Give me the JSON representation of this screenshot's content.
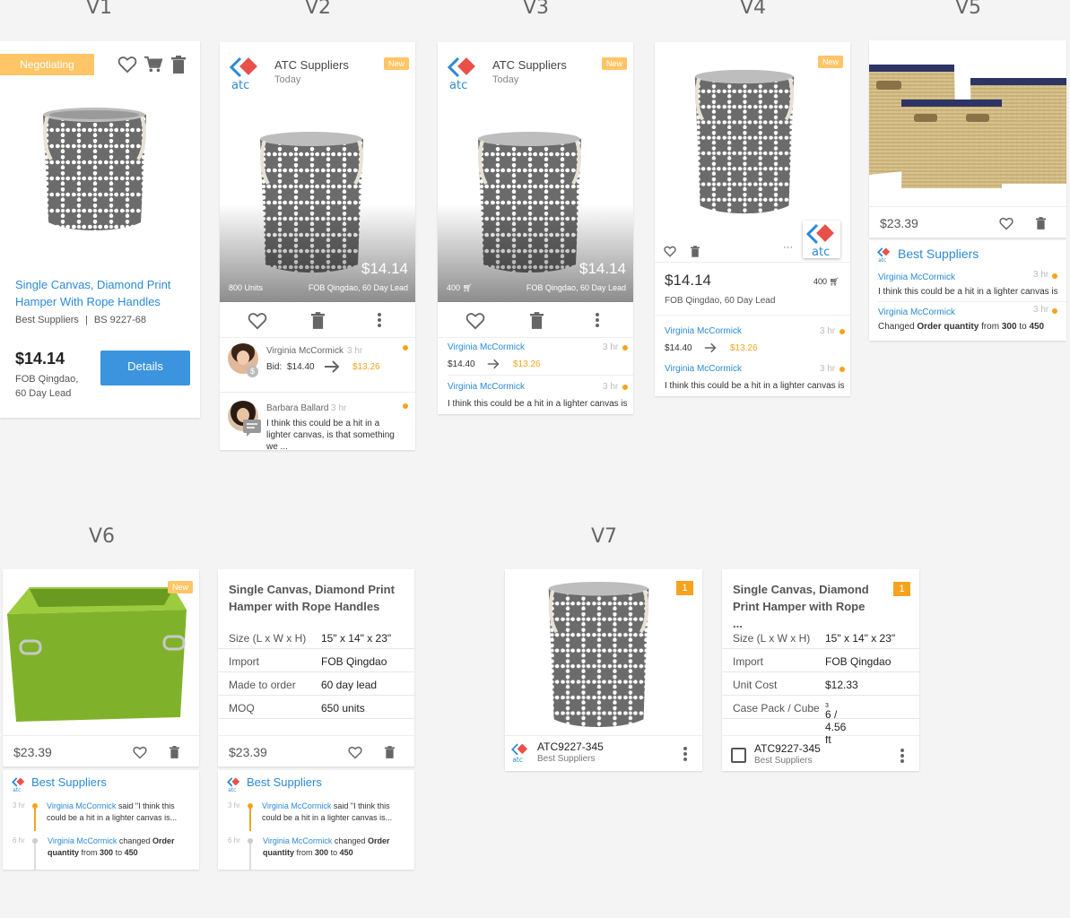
{
  "version_labels": [
    "V1",
    "V2",
    "V3",
    "V4",
    "V5",
    "V6",
    "V7"
  ],
  "colors": {
    "accent_blue": "#2b8ad6",
    "accent_orange": "#f5a31e",
    "badge_yellow": "#ffc566",
    "green_bin": "#7fb22a"
  },
  "v1": {
    "status_badge": "Negotiating",
    "title": "Single Canvas, Diamond Print Hamper With Rope Handles",
    "supplier": "Best Suppliers",
    "separator": "|",
    "sku": "BS 9227-68",
    "price": "$14.14",
    "terms": "FOB Qingdao, 60 Day Lead",
    "details_label": "Details"
  },
  "v2": {
    "supplier": "ATC Suppliers",
    "date": "Today",
    "badge": "New",
    "price": "$14.14",
    "units": "800 Units",
    "terms": "FOB Qingdao, 60 Day Lead",
    "bid_user": "Virginia McCormick",
    "bid_time": "3 hr",
    "bid_label": "Bid:",
    "bid_from": "$14.40",
    "bid_to": "$13.26",
    "comment_user": "Barbara Ballard",
    "comment_time": "3 hr",
    "comment_text": "I think this could be a hit in a lighter canvas, is that something we ..."
  },
  "v3": {
    "supplier": "ATC Suppliers",
    "date": "Today",
    "badge": "New",
    "price": "$14.14",
    "units": "400",
    "terms": "FOB Qingdao, 60 Day Lead",
    "act1_user": "Virginia McCormick",
    "act1_time": "3 hr",
    "act1_from": "$14.40",
    "act1_to": "$13.26",
    "act2_user": "Virginia McCormick",
    "act2_time": "3 hr",
    "act2_text": "I think this could be a hit in a lighter canvas is..."
  },
  "v4": {
    "badge": "New",
    "price": "$14.14",
    "units": "400",
    "terms": "FOB Qingdao, 60 Day Lead",
    "logo_text": "atc",
    "more": "···",
    "act1_user": "Virginia McCormick",
    "act1_time": "3 hr",
    "act1_from": "$14.40",
    "act1_to": "$13.26",
    "act2_user": "Virginia McCormick",
    "act2_time": "3 hr",
    "act2_text": "I think this could be a hit in a lighter canvas is..."
  },
  "v5": {
    "price": "$23.39",
    "supplier": "Best Suppliers",
    "act1_user": "Virginia McCormick",
    "act1_time": "3 hr",
    "act1_text": "I think this could be a hit in a lighter canvas is...",
    "act2_user": "Virginia McCormick",
    "act2_time": "3 hr",
    "act2_changed": "Changed",
    "act2_field": "Order quantity",
    "act2_from_word": "from",
    "act2_from": "300",
    "act2_to_word": "to",
    "act2_to": "450"
  },
  "v6": {
    "badge": "New",
    "price_a": "$23.39",
    "title": "Single Canvas, Diamond Print Hamper with Rope Handles",
    "specs": [
      {
        "label": "Size (L x W x H)",
        "value": "15\" x 14\" x 23\""
      },
      {
        "label": "Import",
        "value": "FOB Qingdao"
      },
      {
        "label": "Made to order",
        "value": "60 day lead"
      },
      {
        "label": "MOQ",
        "value": "650 units"
      }
    ],
    "price_b": "$23.39",
    "supplier": "Best Suppliers",
    "t1_time": "3 hr",
    "t1_user": "Virginia McCormick",
    "t1_said": "said",
    "t1_text": "\"I think this could be a hit in a lighter canvas is...",
    "t2_time": "6 hr",
    "t2_user": "Virginia McCormick",
    "t2_changed": "changed",
    "t2_field": "Order quantity",
    "t2_from_word": "from",
    "t2_from": "300",
    "t2_to_word": "to",
    "t2_to": "450"
  },
  "v7": {
    "count_badge": "1",
    "sku": "ATC9227-345",
    "supplier": "Best Suppliers",
    "title": "Single Canvas, Diamond Print Hamper with Rope ...",
    "specs": [
      {
        "label": "Size (L x W x H)",
        "value": "15\" x 14\" x 23\""
      },
      {
        "label": "Import",
        "value": "FOB Qingdao"
      },
      {
        "label": "Unit Cost",
        "value": "$12.33"
      },
      {
        "label": "Case Pack / Cube",
        "value": "6 / 4.56 ft"
      }
    ],
    "cube_sup": "3"
  }
}
